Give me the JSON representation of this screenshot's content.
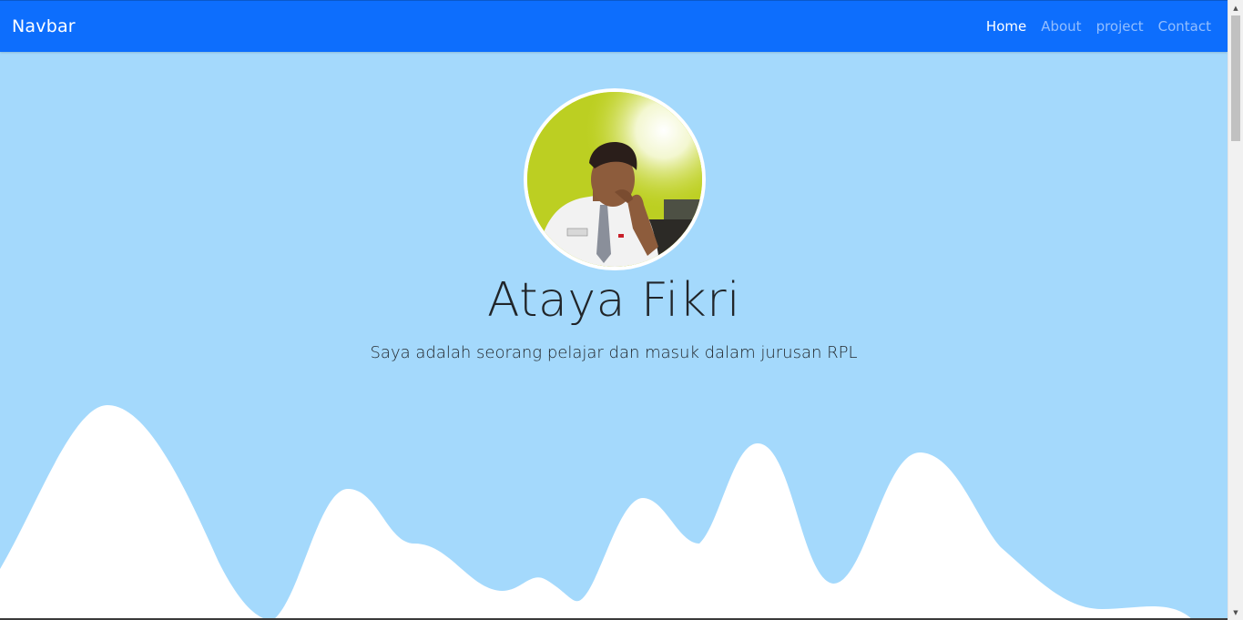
{
  "navbar": {
    "brand": "Navbar",
    "links": [
      {
        "label": "Home",
        "active": true
      },
      {
        "label": "About",
        "active": false
      },
      {
        "label": "project",
        "active": false
      },
      {
        "label": "Contact",
        "active": false
      }
    ]
  },
  "hero": {
    "name": "Ataya Fikri",
    "tagline": "Saya adalah seorang pelajar dan masuk dalam jurusan RPL"
  },
  "colors": {
    "navbar_bg": "#0d6efd",
    "hero_bg": "#a4d9fc",
    "wave_fill": "#ffffff"
  },
  "icons": {
    "scroll_up": "triangle-up-icon",
    "scroll_down": "triangle-down-icon"
  }
}
